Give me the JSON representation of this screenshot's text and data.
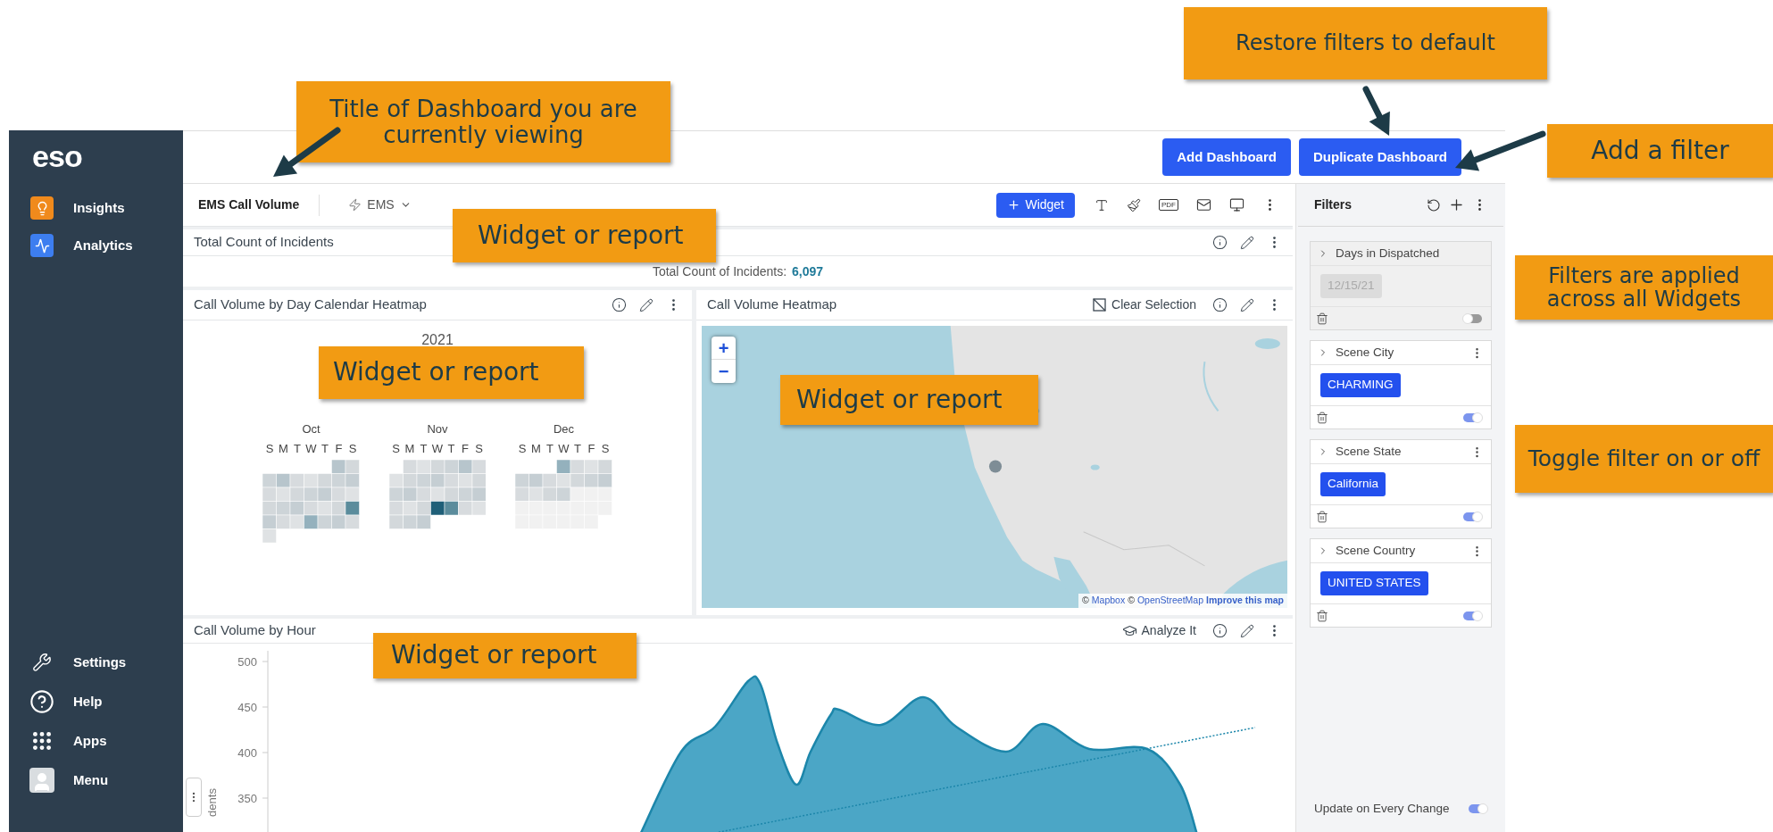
{
  "sidebar": {
    "logo": "eso",
    "items": [
      {
        "label": "Insights",
        "kind": "insights"
      },
      {
        "label": "Analytics",
        "kind": "analytics"
      }
    ],
    "bottom_items": [
      {
        "label": "Settings",
        "kind": "settings"
      },
      {
        "label": "Help",
        "kind": "help"
      },
      {
        "label": "Apps",
        "kind": "apps"
      },
      {
        "label": "Menu",
        "kind": "menu"
      }
    ]
  },
  "header": {
    "buttons": [
      "Add Dashboard",
      "Duplicate Dashboard"
    ]
  },
  "toolbar": {
    "dashboard_title": "EMS Call Volume",
    "category": "EMS",
    "add_widget": "Widget",
    "pdf_label": "PDF"
  },
  "widgets": [
    {
      "kind": "kpi",
      "title": "Total Count of Incidents",
      "label": "Total Count of Incidents:",
      "value": "6,097"
    },
    {
      "kind": "calendar",
      "title": "Call Volume by Day Calendar Heatmap",
      "year": "2021",
      "months": [
        {
          "name": "Oct",
          "weekdays": [
            "S",
            "M",
            "T",
            "W",
            "T",
            "F",
            "S"
          ]
        },
        {
          "name": "Nov",
          "weekdays": [
            "S",
            "M",
            "T",
            "W",
            "T",
            "F",
            "S"
          ]
        },
        {
          "name": "Dec",
          "weekdays": [
            "S",
            "M",
            "T",
            "W",
            "T",
            "F",
            "S"
          ]
        }
      ]
    },
    {
      "kind": "map",
      "title": "Call Volume Heatmap",
      "action": "Clear Selection",
      "zoom_in": "+",
      "zoom_out": "−",
      "attribution": [
        {
          "kind": "text",
          "text": "©"
        },
        {
          "kind": "link",
          "text": "Mapbox"
        },
        {
          "kind": "text",
          "text": "©"
        },
        {
          "kind": "link",
          "text": "OpenStreetMap"
        },
        {
          "kind": "strong_link",
          "text": "Improve this map"
        }
      ]
    },
    {
      "kind": "area",
      "title": "Call Volume by Hour",
      "action": "Analyze It",
      "yticks": [
        "500",
        "450",
        "400",
        "350"
      ],
      "ylabel": "dents"
    }
  ],
  "filters": {
    "title": "Filters",
    "items": [
      {
        "label": "Days in Dispatched",
        "value": "12/15/21",
        "enabled": false
      },
      {
        "label": "Scene City",
        "value": "CHARMING",
        "enabled": true
      },
      {
        "label": "Scene State",
        "value": "California",
        "enabled": true
      },
      {
        "label": "Scene Country",
        "value": "UNITED STATES",
        "enabled": true
      }
    ],
    "footer": {
      "label": "Update on Every Change",
      "on": true
    }
  },
  "callouts": [
    {
      "text": "Title of Dashboard you are currently viewing"
    },
    {
      "text": "Restore filters to default"
    },
    {
      "text": "Add a filter"
    },
    {
      "text": "Filters are applied across all Widgets"
    },
    {
      "text": "Toggle filter on or off"
    },
    {
      "text": "Widget or report"
    },
    {
      "text": "Widget or report"
    },
    {
      "text": "Widget or report"
    },
    {
      "text": "Widget or report"
    }
  ]
}
